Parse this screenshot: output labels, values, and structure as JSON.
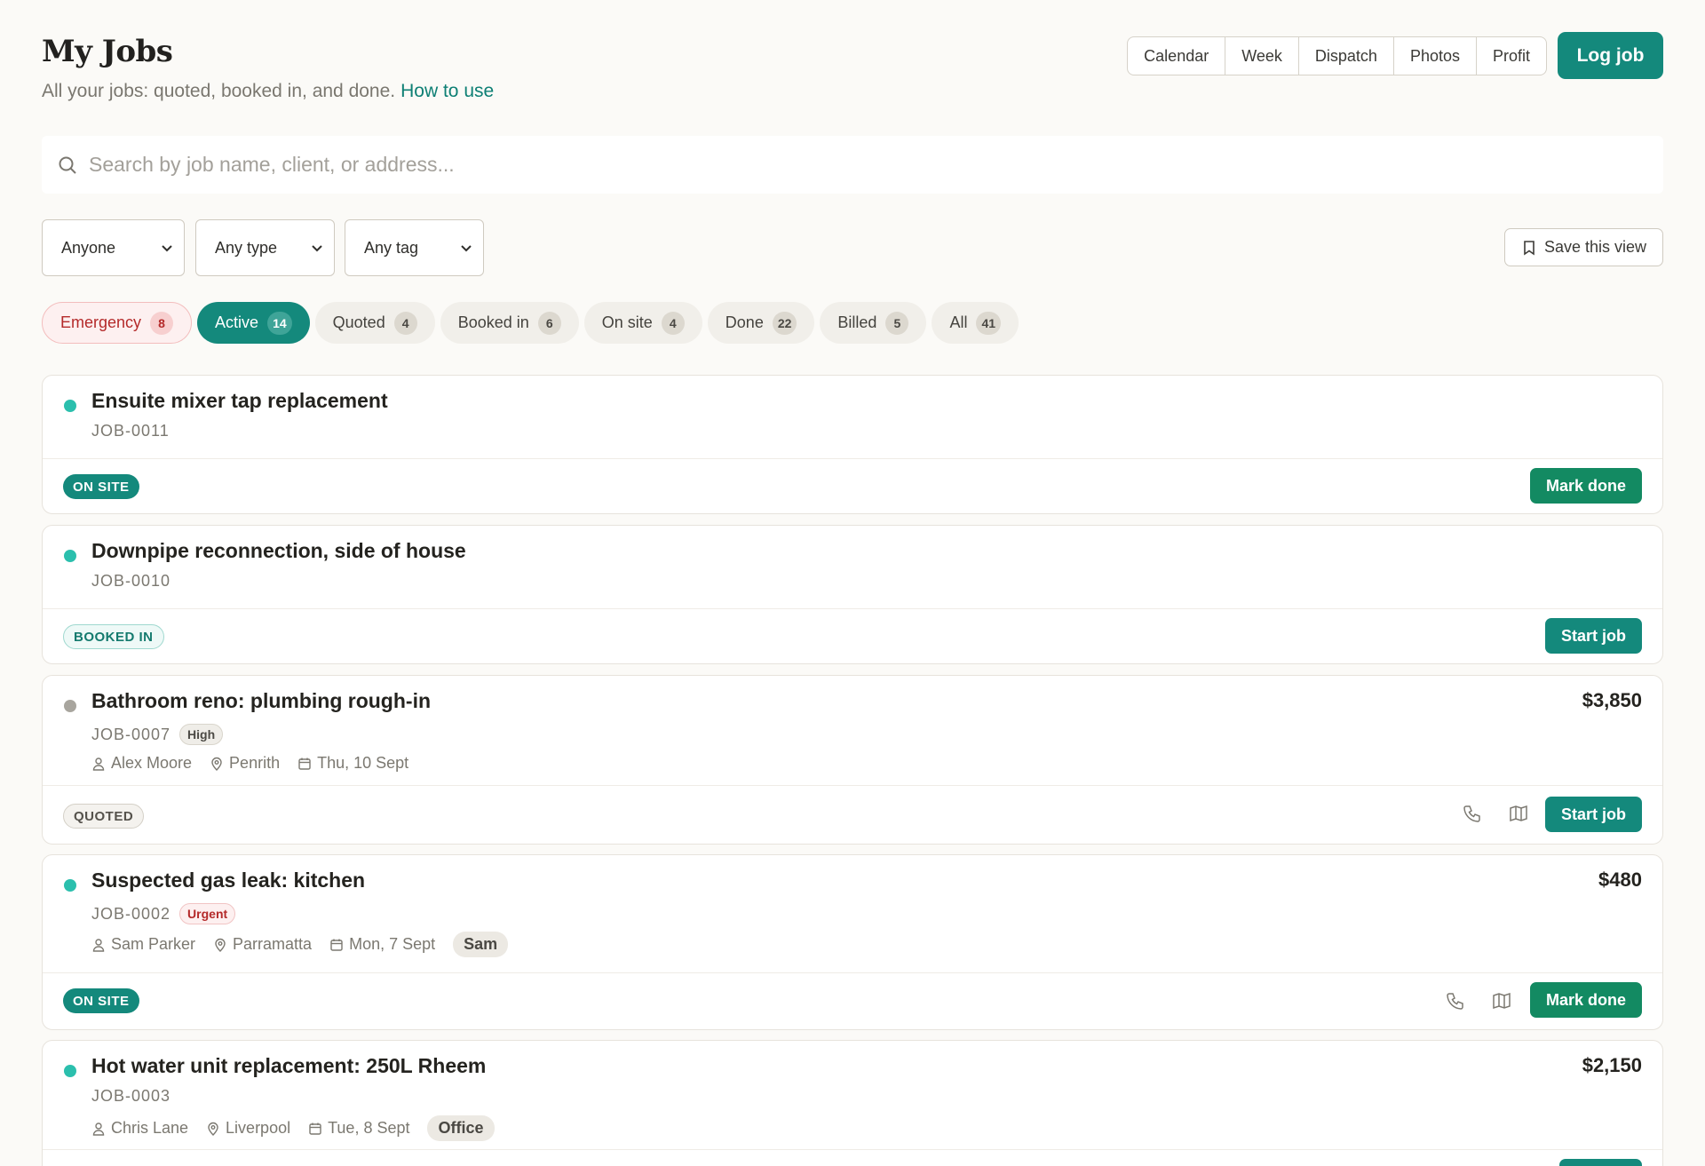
{
  "header": {
    "title": "My Jobs",
    "subtitle": "All your jobs: quoted, booked in, and done.",
    "help_link": "How to use",
    "views": [
      "Calendar",
      "Week",
      "Dispatch",
      "Photos",
      "Profit"
    ],
    "log_job": "Log job"
  },
  "search": {
    "placeholder": "Search by job name, client, or address..."
  },
  "filters": {
    "person": "Anyone",
    "type": "Any type",
    "tag": "Any tag",
    "save_view": "Save this view"
  },
  "status_tabs": [
    {
      "label": "Emergency",
      "count": "8"
    },
    {
      "label": "Active",
      "count": "14"
    },
    {
      "label": "Quoted",
      "count": "4"
    },
    {
      "label": "Booked in",
      "count": "6"
    },
    {
      "label": "On site",
      "count": "4"
    },
    {
      "label": "Done",
      "count": "22"
    },
    {
      "label": "Billed",
      "count": "5"
    },
    {
      "label": "All",
      "count": "41"
    }
  ],
  "jobs": [
    {
      "title": "Ensuite mixer tap replacement",
      "job_no": "JOB-0011",
      "status": "ON SITE",
      "action": "Mark done"
    },
    {
      "title": "Downpipe reconnection, side of house",
      "job_no": "JOB-0010",
      "status": "BOOKED IN",
      "action": "Start job"
    },
    {
      "title": "Bathroom reno: plumbing rough-in",
      "job_no": "JOB-0007",
      "priority": "High",
      "price": "$3,850",
      "client": "Alex Moore",
      "suburb": "Penrith",
      "date": "Thu, 10 Sept",
      "status": "QUOTED",
      "action": "Start job"
    },
    {
      "title": "Suspected gas leak: kitchen",
      "job_no": "JOB-0002",
      "priority": "Urgent",
      "price": "$480",
      "client": "Sam Parker",
      "suburb": "Parramatta",
      "date": "Mon, 7 Sept",
      "tag": "Sam",
      "status": "ON SITE",
      "action": "Mark done"
    },
    {
      "title": "Hot water unit replacement: 250L Rheem",
      "job_no": "JOB-0003",
      "price": "$2,150",
      "client": "Chris Lane",
      "suburb": "Liverpool",
      "date": "Tue, 8 Sept",
      "tag": "Office"
    }
  ],
  "colors": {
    "accent": "#14897c",
    "mark_done": "#138a62",
    "dot_active": "#2bbfad",
    "dot_quoted": "#a8a59e",
    "emergency": "#b42a2a"
  },
  "icons": [
    "search-icon",
    "chevron-down-icon",
    "bookmark-icon",
    "user-icon",
    "map-pin-icon",
    "calendar-icon",
    "phone-icon",
    "map-icon"
  ]
}
